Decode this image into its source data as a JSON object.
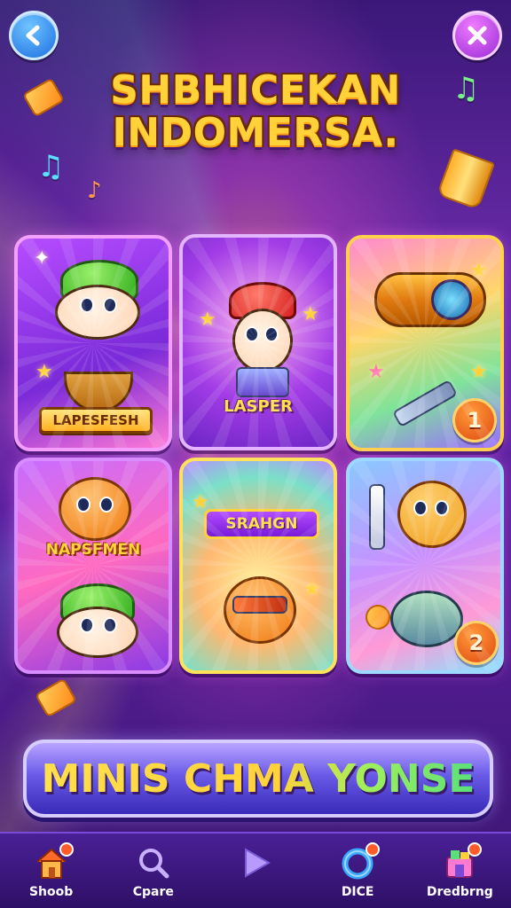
{
  "header": {
    "title_line1": "SHBHICEKAN",
    "title_line2": "INDOMERSA.",
    "back_icon": "chevron-left-icon",
    "close_icon": "close-icon"
  },
  "cards": [
    {
      "label": "LAPESFESH",
      "style": "ribbon"
    },
    {
      "label": "LASPER",
      "style": "plain"
    },
    {
      "label": "",
      "badge": "1"
    },
    {
      "label": "NAPSFMEN",
      "style": "orange"
    },
    {
      "label": "SRAHGN",
      "style": "pill"
    },
    {
      "label": "",
      "badge": "2"
    }
  ],
  "banner": {
    "text": "MINIS CHMA YONSE"
  },
  "nav": [
    {
      "label": "Shoob",
      "icon": "home-icon",
      "dot": true
    },
    {
      "label": "Cpare",
      "icon": "search-icon",
      "dot": false
    },
    {
      "label": "",
      "icon": "play-icon",
      "dot": false
    },
    {
      "label": "DICE",
      "icon": "ring-icon",
      "dot": true
    },
    {
      "label": "Dredbrng",
      "icon": "shop-icon",
      "dot": true
    }
  ],
  "colors": {
    "title": "#ffd23a",
    "background": "#5a1f9e",
    "badge": "#e04a10",
    "banner": "#6a5ae8"
  }
}
